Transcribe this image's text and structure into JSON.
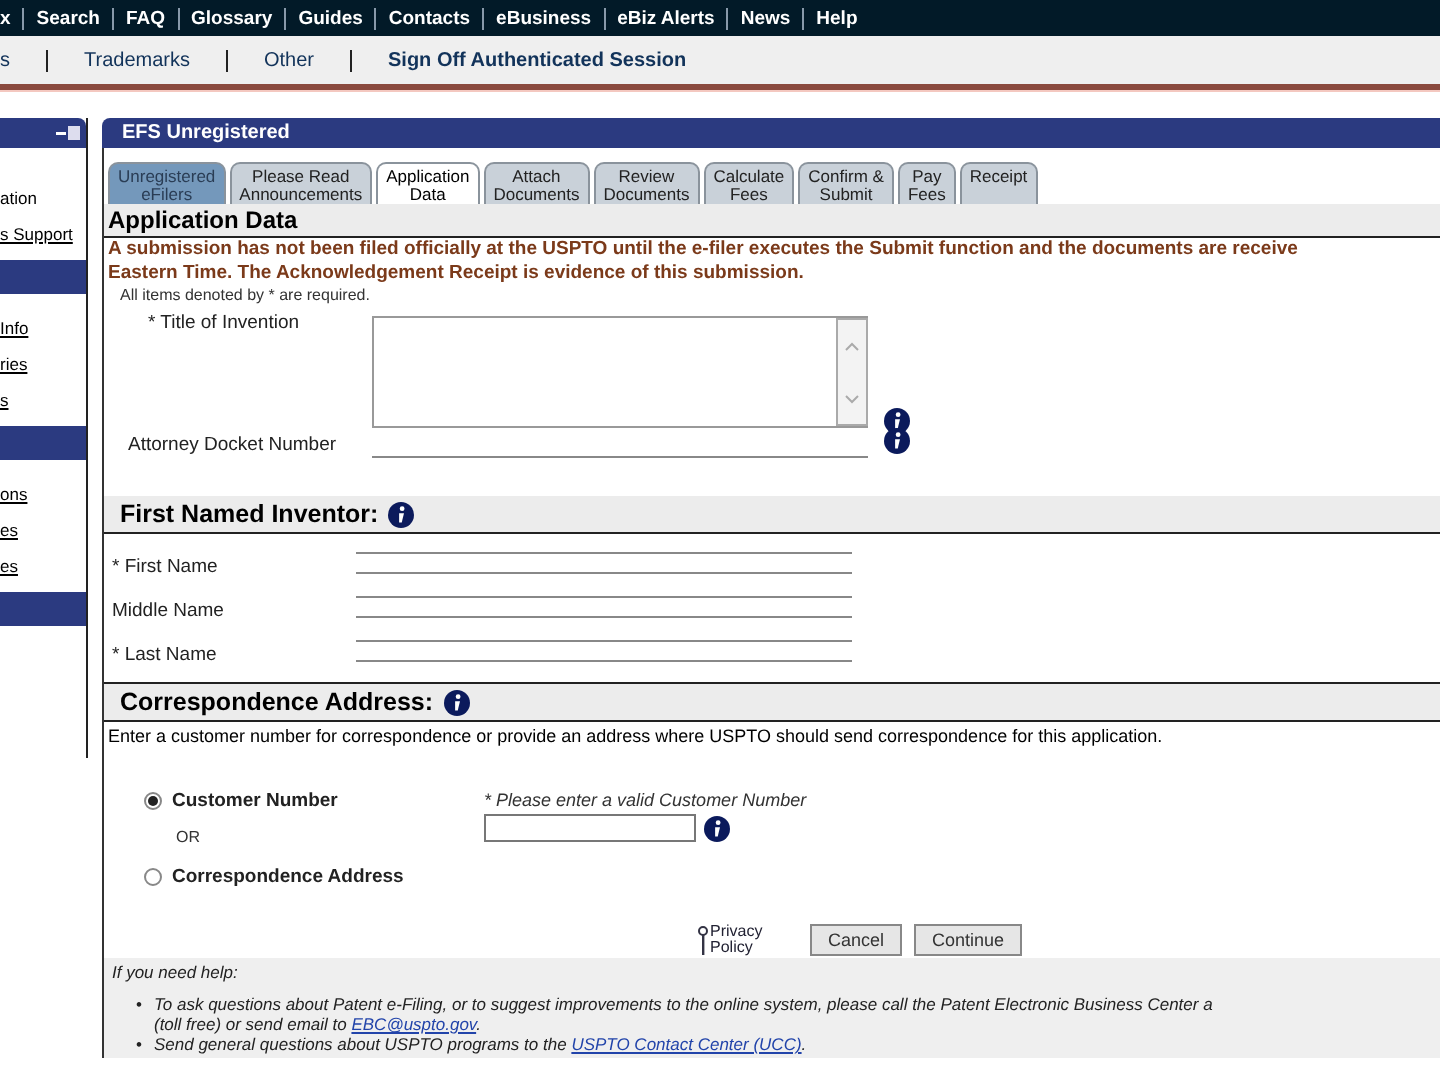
{
  "top_nav": [
    "x",
    "Search",
    "FAQ",
    "Glossary",
    "Guides",
    "Contacts",
    "eBusiness",
    "eBiz Alerts",
    "News",
    "Help"
  ],
  "sub_nav": [
    "s",
    "Trademarks",
    "Other",
    "Sign Off Authenticated Session"
  ],
  "sidebar": {
    "items": [
      {
        "kind": "header"
      },
      {
        "kind": "text",
        "label": "ation"
      },
      {
        "kind": "link",
        "label": "s Support"
      },
      {
        "kind": "band"
      },
      {
        "kind": "link",
        "label": "Info"
      },
      {
        "kind": "link",
        "label": "ries"
      },
      {
        "kind": "link",
        "label": "s"
      },
      {
        "kind": "band"
      },
      {
        "kind": "link",
        "label": "ons"
      },
      {
        "kind": "link",
        "label": "es"
      },
      {
        "kind": "link",
        "label": "es"
      },
      {
        "kind": "band"
      }
    ]
  },
  "panel": {
    "title": "EFS Unregistered"
  },
  "tabs": [
    {
      "label": "Unregistered\neFilers",
      "selected": false,
      "completed": true
    },
    {
      "label": "Please Read\nAnnouncements",
      "selected": false,
      "completed": false
    },
    {
      "label": "Application\nData",
      "selected": true,
      "completed": false
    },
    {
      "label": "Attach\nDocuments",
      "selected": false,
      "completed": false
    },
    {
      "label": "Review\nDocuments",
      "selected": false,
      "completed": false
    },
    {
      "label": "Calculate\nFees",
      "selected": false,
      "completed": false
    },
    {
      "label": "Confirm &\nSubmit",
      "selected": false,
      "completed": false
    },
    {
      "label": "Pay\nFees",
      "selected": false,
      "completed": false
    },
    {
      "label": "Receipt",
      "selected": false,
      "completed": false
    }
  ],
  "form": {
    "heading": "Application Data",
    "notice": [
      "A submission has not been filed officially at the USPTO until the e-filer executes the Submit function and the documents are receive",
      "Eastern Time. The Acknowledgement Receipt is evidence of this submission."
    ],
    "required_note": "All items denoted by * are required.",
    "fields": [
      {
        "kind": "textarea",
        "label": "* Title of Invention",
        "info": true
      },
      {
        "kind": "line",
        "label": "Attorney Docket Number",
        "info": true
      }
    ]
  },
  "inventor": {
    "heading": "First Named Inventor:",
    "fields": [
      "* First Name",
      "Middle Name",
      "* Last Name"
    ]
  },
  "correspondence": {
    "heading": "Correspondence Address:",
    "intro": "Enter a customer number for correspondence or provide an address where USPTO should send correspondence for this application.",
    "options": [
      {
        "label": "Customer Number",
        "selected": true
      },
      {
        "label": "Correspondence Address",
        "selected": false
      }
    ],
    "or": "OR",
    "hint": "* Please enter a valid Customer Number"
  },
  "actions": {
    "privacy": "Privacy Policy",
    "buttons": [
      "Cancel",
      "Continue"
    ]
  },
  "help": {
    "title": "If you need help:",
    "items": [
      {
        "bullet": "•",
        "lines": [
          {
            "text": "To ask questions about Patent e-Filing, or to suggest improvements to the online system, please call the Patent Electronic Business Center a"
          },
          {
            "text": "(toll free) or send email to ",
            "link": "EBC@uspto.gov",
            "after": "."
          }
        ]
      },
      {
        "bullet": "•",
        "lines": [
          {
            "text": "Send general questions about USPTO programs to the ",
            "link": "USPTO Contact Center (UCC)",
            "after": "."
          }
        ]
      }
    ]
  }
}
